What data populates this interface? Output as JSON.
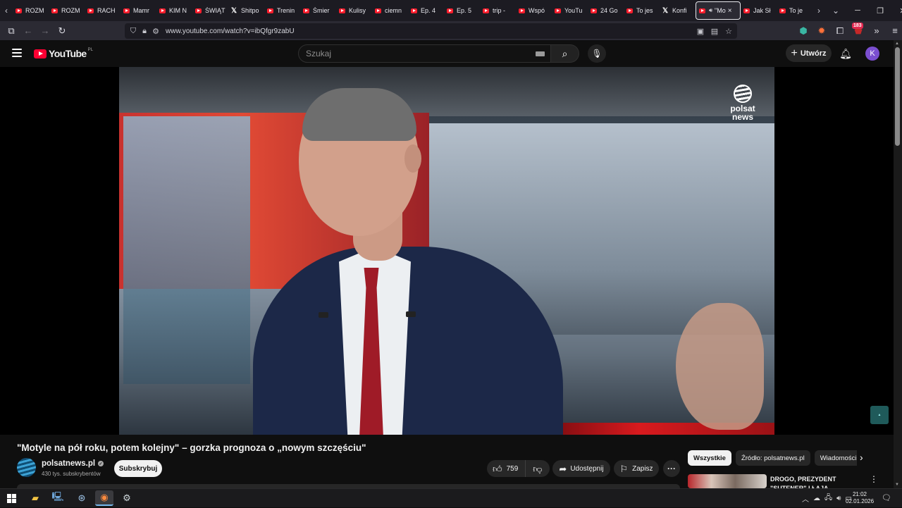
{
  "browser": {
    "tabs": [
      {
        "label": "ROZM",
        "icon": "youtube-icon"
      },
      {
        "label": "ROZM",
        "icon": "youtube-icon"
      },
      {
        "label": "RACH",
        "icon": "youtube-icon"
      },
      {
        "label": "Mamr",
        "icon": "youtube-icon"
      },
      {
        "label": "KIM N",
        "icon": "youtube-icon"
      },
      {
        "label": "ŚWIĄT",
        "icon": "youtube-icon"
      },
      {
        "label": "Shitpo",
        "icon": "x-icon"
      },
      {
        "label": "Trenin",
        "icon": "youtube-icon"
      },
      {
        "label": "Śmier",
        "icon": "youtube-icon"
      },
      {
        "label": "Kulisy",
        "icon": "youtube-icon"
      },
      {
        "label": "ciemn",
        "icon": "youtube-icon"
      },
      {
        "label": "Ep. 4",
        "icon": "youtube-icon"
      },
      {
        "label": "Ep. 5",
        "icon": "youtube-icon"
      },
      {
        "label": "trip - ",
        "icon": "youtube-icon"
      },
      {
        "label": "Wspó",
        "icon": "youtube-icon"
      },
      {
        "label": "YouTu",
        "icon": "youtube-icon"
      },
      {
        "label": "24 Go",
        "icon": "youtube-icon"
      },
      {
        "label": "To jes",
        "icon": "youtube-icon"
      },
      {
        "label": "Konfi",
        "icon": "x-icon"
      }
    ],
    "active_tab": {
      "label": "\"Mo",
      "icon": "youtube-icon"
    },
    "tabs_after": [
      {
        "label": "Jak Sł",
        "icon": "youtube-icon"
      },
      {
        "label": "To je",
        "icon": "youtube-icon"
      }
    ],
    "url": "www.youtube.com/watch?v=ibQfgr9zabU",
    "extension_badge": "183"
  },
  "youtube": {
    "logo_text": "YouTube",
    "country_code": "PL",
    "search_placeholder": "Szukaj",
    "create_label": "Utwórz",
    "avatar_letter": "K"
  },
  "video": {
    "channel_watermark": "polsat news",
    "title": "\"Motyle na pół roku, potem kolejny\" – gorzka prognoza o „nowym szczęściu\"",
    "channel_name": "polsatnews.pl",
    "subscribers": "430 tys. subskrybentów",
    "subscribe_label": "Subskrybuj",
    "likes": "759",
    "share_label": "Udostępnij",
    "save_label": "Zapisz"
  },
  "sidebar": {
    "chips": [
      "Wszystkie",
      "Źródło: polsatnews.pl",
      "Wiadomości"
    ],
    "recommendation_title": "DROGO, PREZYDENT \"SUTENER\" I ŁAJA UKRAIŃCÓW"
  },
  "taskbar": {
    "time": "21:02",
    "date": "02.01.2026"
  },
  "colors": {
    "background": "#0f0f0f",
    "youtube_red": "#ff0033",
    "avatar": "#7b4fd0"
  }
}
